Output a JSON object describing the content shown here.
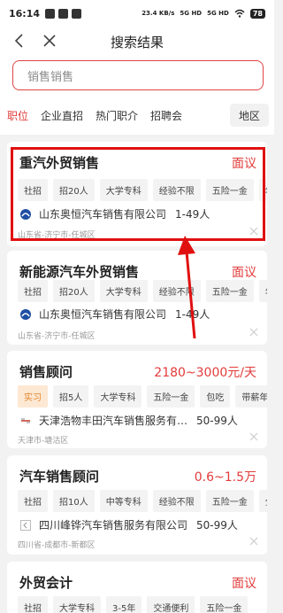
{
  "status": {
    "time": "16:14",
    "net_speed": "23.4 KB/s",
    "signal1": "5G HD",
    "signal2": "5G HD",
    "battery": "78"
  },
  "header": {
    "title": "搜索结果"
  },
  "search": {
    "value": "销售销售"
  },
  "filter_tabs": [
    "职位",
    "企业直招",
    "热门职介",
    "招聘会"
  ],
  "region_button": "地区",
  "jobs": [
    {
      "title": "重汽外贸销售",
      "salary": "面议",
      "tags": [
        "社招",
        "招20人",
        "大学专科",
        "经验不限",
        "五险一金",
        "年"
      ],
      "company": "山东奥恒汽车销售有限公司",
      "size": "1-49人",
      "location": "山东省-济宁市-任城区"
    },
    {
      "title": "新能源汽车外贸销售",
      "salary": "面议",
      "tags": [
        "社招",
        "招20人",
        "大学专科",
        "经验不限",
        "五险一金",
        "年"
      ],
      "company": "山东奥恒汽车销售有限公司",
      "size": "1-49人",
      "location": "山东省-济宁市-任城区"
    },
    {
      "title": "销售顾问",
      "salary": "2180~3000元/天",
      "tags": [
        "实习",
        "招5人",
        "大学专科",
        "五险一金",
        "包吃",
        "带薪年假"
      ],
      "company": "天津浩物丰田汽车销售服务有…",
      "size": "50-99人",
      "location": "天津市-塘沽区"
    },
    {
      "title": "汽车销售顾问",
      "salary": "0.6~1.5万",
      "tags": [
        "社招",
        "招10人",
        "中等专科",
        "经验不限",
        "五险一金",
        "全"
      ],
      "company": "四川峰铧汽车销售服务有限公司",
      "size": "50-99人",
      "location": "四川省-成都市-新都区"
    },
    {
      "title": "外贸会计",
      "salary": "面议",
      "tags": [
        "社招",
        "大学专科",
        "3-5年",
        "交通便利",
        "五险一金"
      ]
    }
  ]
}
